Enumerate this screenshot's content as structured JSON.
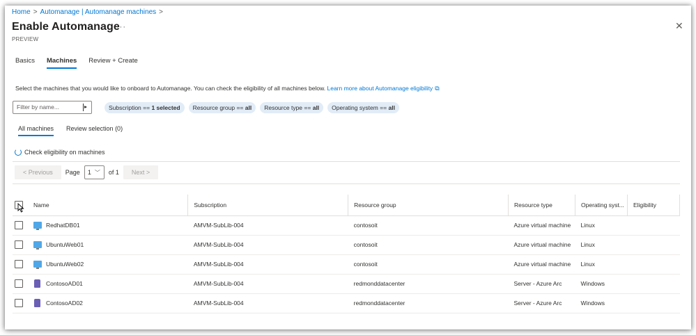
{
  "breadcrumb": {
    "items": [
      "Home",
      "Automanage | Automanage machines"
    ],
    "separator": ">"
  },
  "header": {
    "title": "Enable Automanage",
    "more": "···",
    "subtitle": "PREVIEW",
    "close": "✕"
  },
  "tabs": [
    {
      "label": "Basics",
      "active": false
    },
    {
      "label": "Machines",
      "active": true
    },
    {
      "label": "Review + Create",
      "active": false
    }
  ],
  "description": {
    "text": "Select the machines that you would like to onboard to Automanage. You can check the eligibility of all machines below.",
    "link": "Learn more about Automanage eligibility"
  },
  "filter": {
    "placeholder": "Filter by name..."
  },
  "pills": [
    {
      "key": "Subscription",
      "op": "==",
      "value": "1 selected"
    },
    {
      "key": "Resource group",
      "op": "==",
      "value": "all"
    },
    {
      "key": "Resource type",
      "op": "==",
      "value": "all"
    },
    {
      "key": "Operating system",
      "op": "==",
      "value": "all"
    }
  ],
  "subtabs": [
    {
      "label": "All machines",
      "active": true
    },
    {
      "label": "Review selection (0)",
      "active": false
    }
  ],
  "check_eligibility": "Check eligibility on machines",
  "pager": {
    "previous": "< Previous",
    "page_label": "Page",
    "page_value": "1",
    "of_label": "of 1",
    "next": "Next >"
  },
  "table": {
    "columns": [
      "Name",
      "Subscription",
      "Resource group",
      "Resource type",
      "Operating syst...",
      "Eligibility"
    ],
    "rows": [
      {
        "name": "RedhatDB01",
        "icon": "vm-icon",
        "subscription": "AMVM-SubLib-004",
        "resource_group": "contosoit",
        "resource_type": "Azure virtual machine",
        "os": "Linux",
        "eligibility": ""
      },
      {
        "name": "UbuntuWeb01",
        "icon": "vm-icon",
        "subscription": "AMVM-SubLib-004",
        "resource_group": "contosoit",
        "resource_type": "Azure virtual machine",
        "os": "Linux",
        "eligibility": ""
      },
      {
        "name": "UbuntuWeb02",
        "icon": "vm-icon",
        "subscription": "AMVM-SubLib-004",
        "resource_group": "contosoit",
        "resource_type": "Azure virtual machine",
        "os": "Linux",
        "eligibility": ""
      },
      {
        "name": "ContosoAD01",
        "icon": "arc-server-icon",
        "subscription": "AMVM-SubLib-004",
        "resource_group": "redmonddatacenter",
        "resource_type": "Server - Azure Arc",
        "os": "Windows",
        "eligibility": ""
      },
      {
        "name": "ContosoAD02",
        "icon": "arc-server-icon",
        "subscription": "AMVM-SubLib-004",
        "resource_group": "redmonddatacenter",
        "resource_type": "Server - Azure Arc",
        "os": "Windows",
        "eligibility": ""
      }
    ]
  },
  "colors": {
    "accent": "#0078d4",
    "pill_bg": "#e1ecf7",
    "text": "#323130"
  }
}
